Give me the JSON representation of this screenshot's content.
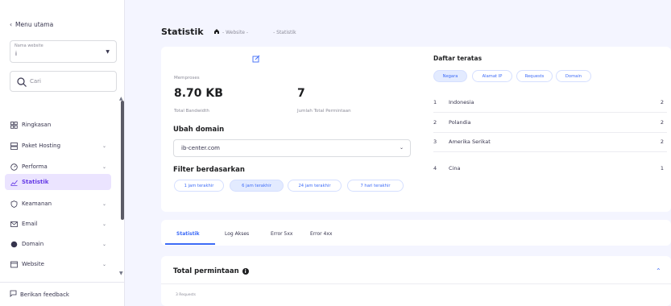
{
  "sidebar": {
    "back_label": "Menu utama",
    "website_select": {
      "label": "Nama website",
      "value": "i"
    },
    "search_placeholder": "Cari",
    "items": [
      {
        "label": "Ringkasan",
        "icon": "grid-icon",
        "has_chevron": false
      },
      {
        "label": "Paket Hosting",
        "icon": "server-icon",
        "has_chevron": true
      },
      {
        "label": "Performa",
        "icon": "gauge-icon",
        "has_chevron": true
      },
      {
        "label": "Statistik",
        "icon": "chart-icon",
        "has_chevron": false,
        "active": true
      },
      {
        "label": "Keamanan",
        "icon": "shield-icon",
        "has_chevron": true
      },
      {
        "label": "Email",
        "icon": "mail-icon",
        "has_chevron": true
      },
      {
        "label": "Domain",
        "icon": "globe-icon",
        "has_chevron": true
      },
      {
        "label": "Website",
        "icon": "window-icon",
        "has_chevron": true
      }
    ],
    "feedback_label": "Berikan feedback"
  },
  "header": {
    "title": "Statistik",
    "breadcrumb": [
      "- Website -",
      "- Statistik"
    ]
  },
  "stats": {
    "processing_label": "Memproses",
    "bandwidth_value": "8.70 KB",
    "bandwidth_label": "Total Bandwidth",
    "requests_value": "7",
    "requests_label": "Jumlah Total Permintaan",
    "change_domain_title": "Ubah domain",
    "domain_value": "ib-center.com",
    "filter_title": "Filter berdasarkan",
    "filters": [
      "1 jam terakhir",
      "6 jam terakhir",
      "24 jam terakhir",
      "7 hari terakhir"
    ],
    "active_filter": 1
  },
  "top_list": {
    "title": "Daftar teratas",
    "tabs": [
      "Negara",
      "Alamat IP",
      "Requests",
      "Domain"
    ],
    "active_tab": 0,
    "rows": [
      {
        "idx": "1",
        "name": "Indonesia",
        "count": "2"
      },
      {
        "idx": "2",
        "name": "Polandia",
        "count": "2"
      },
      {
        "idx": "3",
        "name": "Amerika Serikat",
        "count": "2"
      },
      {
        "idx": "4",
        "name": "Cina",
        "count": "1"
      }
    ]
  },
  "tabs": [
    "Statistik",
    "Log Akses",
    "Error 5xx",
    "Error 4xx"
  ],
  "bottom": {
    "title": "Total permintaan",
    "yaxis_label": "3 Requests"
  },
  "colors": {
    "accent": "#673de6",
    "link": "#3d6bf7",
    "background": "#f4f5ff"
  }
}
